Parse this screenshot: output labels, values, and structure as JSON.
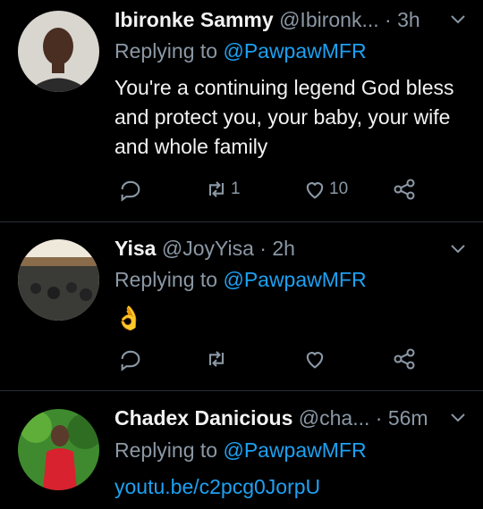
{
  "tweets": [
    {
      "name": "Ibironke Sammy",
      "handle": "@Ibironk...",
      "time": "· 3h",
      "reply_prefix": "Replying to",
      "reply_to": "@PawpawMFR",
      "text": "You're a continuing legend God bless and protect you, your baby, your wife and whole family",
      "retweets": "1",
      "likes": "10"
    },
    {
      "name": "Yisa",
      "handle": "@JoyYisa",
      "time": "· 2h",
      "reply_prefix": "Replying to",
      "reply_to": "@PawpawMFR",
      "text": "👌",
      "retweets": "",
      "likes": ""
    },
    {
      "name": "Chadex Danicious",
      "handle": "@cha...",
      "time": "· 56m",
      "reply_prefix": "Replying to",
      "reply_to": "@PawpawMFR",
      "link": "youtu.be/c2pcg0JorpU"
    }
  ],
  "colors": {
    "link": "#1da1f2",
    "muted": "#8b98a5",
    "background": "#000000"
  }
}
